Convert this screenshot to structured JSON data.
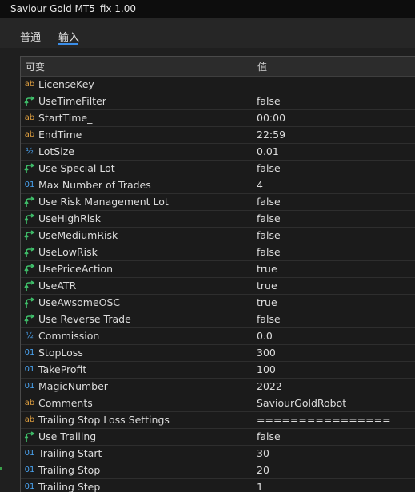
{
  "window": {
    "title": "Saviour Gold MT5_fix 1.00"
  },
  "tabs": [
    {
      "label": "普通",
      "active": false
    },
    {
      "label": "输入",
      "active": true
    }
  ],
  "table": {
    "headers": {
      "name": "可变",
      "value": "值"
    },
    "rows": [
      {
        "icon": "ab",
        "name": "LicenseKey",
        "value": ""
      },
      {
        "icon": "bool",
        "name": "UseTimeFilter",
        "value": "false"
      },
      {
        "icon": "ab",
        "name": "StartTime_",
        "value": "00:00"
      },
      {
        "icon": "ab",
        "name": "EndTime",
        "value": "22:59"
      },
      {
        "icon": "half",
        "name": "LotSize",
        "value": "0.01"
      },
      {
        "icon": "bool",
        "name": "Use Special Lot",
        "value": "false"
      },
      {
        "icon": "01",
        "name": "Max Number of Trades",
        "value": "4"
      },
      {
        "icon": "bool",
        "name": "Use Risk Management Lot",
        "value": "false"
      },
      {
        "icon": "bool",
        "name": "UseHighRisk",
        "value": "false"
      },
      {
        "icon": "bool",
        "name": "UseMediumRisk",
        "value": "false"
      },
      {
        "icon": "bool",
        "name": "UseLowRisk",
        "value": "false"
      },
      {
        "icon": "bool",
        "name": "UsePriceAction",
        "value": "true"
      },
      {
        "icon": "bool",
        "name": "UseATR",
        "value": "true"
      },
      {
        "icon": "bool",
        "name": "UseAwsomeOSC",
        "value": "true"
      },
      {
        "icon": "bool",
        "name": "Use Reverse Trade",
        "value": "false"
      },
      {
        "icon": "half",
        "name": "Commission",
        "value": "0.0"
      },
      {
        "icon": "01",
        "name": "StopLoss",
        "value": "300"
      },
      {
        "icon": "01",
        "name": "TakeProfit",
        "value": "100"
      },
      {
        "icon": "01",
        "name": "MagicNumber",
        "value": "2022"
      },
      {
        "icon": "ab",
        "name": "Comments",
        "value": "SaviourGoldRobot"
      },
      {
        "icon": "ab",
        "name": "Trailing Stop Loss Settings",
        "value": "================"
      },
      {
        "icon": "bool",
        "name": "Use Trailing",
        "value": "false"
      },
      {
        "icon": "01",
        "name": "Trailing Start",
        "value": "30"
      },
      {
        "icon": "01",
        "name": "Trailing Stop",
        "value": "20"
      },
      {
        "icon": "01",
        "name": "Trailing Step",
        "value": "1"
      }
    ]
  },
  "icons": {
    "ab": {
      "glyph": "ab",
      "name": "string-type-icon",
      "color": "#e0a040"
    },
    "01": {
      "glyph": "01",
      "name": "integer-type-icon",
      "color": "#4aa3f0"
    },
    "half": {
      "glyph": "½",
      "name": "double-type-icon",
      "color": "#4aa3f0"
    },
    "bool": {
      "glyph": "",
      "name": "bool-type-icon",
      "color": "#3fc06a"
    }
  }
}
